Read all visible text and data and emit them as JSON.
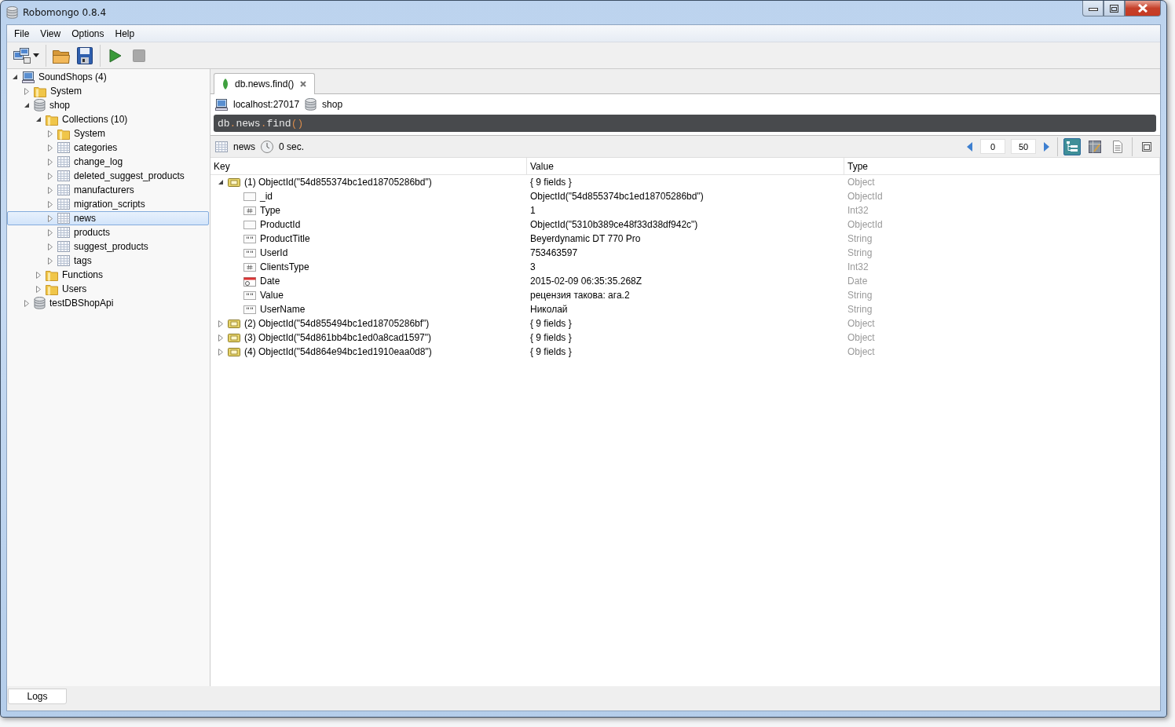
{
  "window": {
    "title": "Robomongo 0.8.4"
  },
  "menu": [
    "File",
    "View",
    "Options",
    "Help"
  ],
  "tree": [
    {
      "label": "SoundShops (4)",
      "kind": "server",
      "expanded": true,
      "selected": false,
      "children": [
        {
          "label": "System",
          "kind": "folder",
          "expanded": false,
          "selected": false
        },
        {
          "label": "shop",
          "kind": "database",
          "expanded": true,
          "selected": false,
          "children": [
            {
              "label": "Collections (10)",
              "kind": "folder",
              "expanded": true,
              "selected": false,
              "children": [
                {
                  "label": "System",
                  "kind": "folder",
                  "expanded": false,
                  "selected": false
                },
                {
                  "label": "categories",
                  "kind": "collection",
                  "expanded": false,
                  "selected": false
                },
                {
                  "label": "change_log",
                  "kind": "collection",
                  "expanded": false,
                  "selected": false
                },
                {
                  "label": "deleted_suggest_products",
                  "kind": "collection",
                  "expanded": false,
                  "selected": false
                },
                {
                  "label": "manufacturers",
                  "kind": "collection",
                  "expanded": false,
                  "selected": false
                },
                {
                  "label": "migration_scripts",
                  "kind": "collection",
                  "expanded": false,
                  "selected": false
                },
                {
                  "label": "news",
                  "kind": "collection",
                  "expanded": false,
                  "selected": true
                },
                {
                  "label": "products",
                  "kind": "collection",
                  "expanded": false,
                  "selected": false
                },
                {
                  "label": "suggest_products",
                  "kind": "collection",
                  "expanded": false,
                  "selected": false
                },
                {
                  "label": "tags",
                  "kind": "collection",
                  "expanded": false,
                  "selected": false
                }
              ]
            },
            {
              "label": "Functions",
              "kind": "folder",
              "expanded": false,
              "selected": false
            },
            {
              "label": "Users",
              "kind": "folder",
              "expanded": false,
              "selected": false
            }
          ]
        },
        {
          "label": "testDBShopApi",
          "kind": "database",
          "expanded": false,
          "selected": false
        }
      ]
    }
  ],
  "query_tabs": [
    {
      "label": "db.news.find()",
      "selected": true
    }
  ],
  "connection": {
    "server": "localhost:27017",
    "database": "shop"
  },
  "query": "db.news.find()",
  "result_bar": {
    "collection": "news",
    "time": "0 sec.",
    "skip": "0",
    "limit": "50"
  },
  "view_modes": [
    {
      "kind": "tree",
      "selected": true
    },
    {
      "kind": "table",
      "selected": false
    },
    {
      "kind": "text",
      "selected": false
    }
  ],
  "columns": [
    "Key",
    "Value",
    "Type"
  ],
  "documents": [
    {
      "key": "(1) ObjectId(\"54d855374bc1ed18705286bd\")",
      "value": "{ 9 fields }",
      "type": "Object",
      "kind": "object",
      "expanded": true,
      "children": [
        {
          "key": "_id",
          "value": "ObjectId(\"54d855374bc1ed18705286bd\")",
          "type": "ObjectId",
          "kind": "objectid"
        },
        {
          "key": "Type",
          "value": "1",
          "type": "Int32",
          "kind": "number"
        },
        {
          "key": "ProductId",
          "value": "ObjectId(\"5310b389ce48f33d38df942c\")",
          "type": "ObjectId",
          "kind": "objectid"
        },
        {
          "key": "ProductTitle",
          "value": "Beyerdynamic DT 770 Pro",
          "type": "String",
          "kind": "string"
        },
        {
          "key": "UserId",
          "value": "753463597",
          "type": "String",
          "kind": "string"
        },
        {
          "key": "ClientsType",
          "value": "3",
          "type": "Int32",
          "kind": "number"
        },
        {
          "key": "Date",
          "value": "2015-02-09 06:35:35.268Z",
          "type": "Date",
          "kind": "date"
        },
        {
          "key": "Value",
          "value": "рецензия такова: ага.2",
          "type": "String",
          "kind": "string"
        },
        {
          "key": "UserName",
          "value": "Николай",
          "type": "String",
          "kind": "string"
        }
      ]
    },
    {
      "key": "(2) ObjectId(\"54d855494bc1ed18705286bf\")",
      "value": "{ 9 fields }",
      "type": "Object",
      "kind": "object",
      "expanded": false
    },
    {
      "key": "(3) ObjectId(\"54d861bb4bc1ed0a8cad1597\")",
      "value": "{ 9 fields }",
      "type": "Object",
      "kind": "object",
      "expanded": false
    },
    {
      "key": "(4) ObjectId(\"54d864e94bc1ed1910eaa0d8\")",
      "value": "{ 9 fields }",
      "type": "Object",
      "kind": "object",
      "expanded": false
    }
  ],
  "bottom_tabs": [
    {
      "label": "Logs",
      "selected": false
    }
  ]
}
